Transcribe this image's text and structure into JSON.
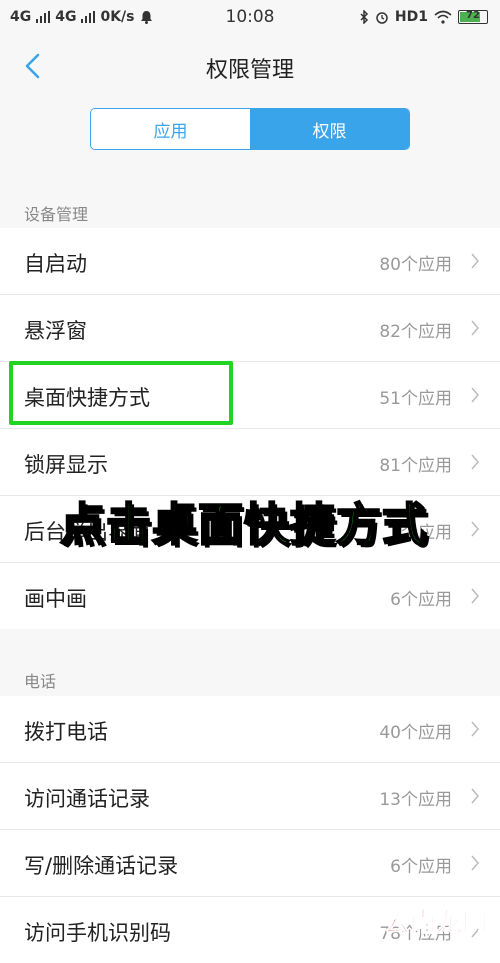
{
  "status_bar": {
    "net1": "4G",
    "net2": "4G",
    "speed": "0K/s",
    "time": "10:08",
    "hd": "HD1",
    "battery": "72"
  },
  "header": {
    "title": "权限管理"
  },
  "segments": {
    "apps": "应用",
    "permissions": "权限",
    "active": "权限",
    "accent_color": "#3aa4ea"
  },
  "sections": [
    {
      "label": "设备管理",
      "items": [
        {
          "name": "自启动",
          "count": "80个应用"
        },
        {
          "name": "悬浮窗",
          "count": "82个应用"
        },
        {
          "name": "桌面快捷方式",
          "count": "51个应用"
        },
        {
          "name": "锁屏显示",
          "count": "81个应用"
        },
        {
          "name": "后台弹出界面",
          "count": "个应用"
        },
        {
          "name": "画中画",
          "count": "6个应用"
        }
      ]
    },
    {
      "label": "电话",
      "items": [
        {
          "name": "拨打电话",
          "count": "40个应用"
        },
        {
          "name": "访问通话记录",
          "count": "13个应用"
        },
        {
          "name": "写/删除通话记录",
          "count": "6个应用"
        },
        {
          "name": "访问手机识别码",
          "count": "78个应用"
        }
      ]
    }
  ],
  "annotation": {
    "text": "点击桌面快捷方式",
    "highlight_color": "#22d322"
  },
  "watermark": "云南龙网"
}
